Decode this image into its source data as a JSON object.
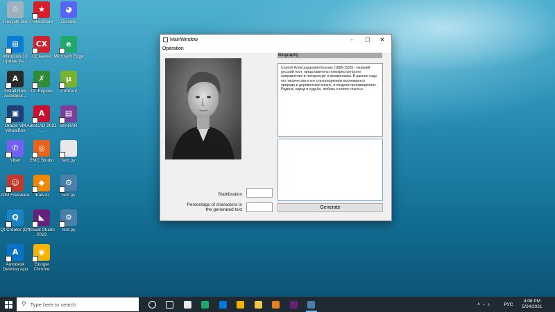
{
  "desktop_icons": [
    {
      "label": "Recycle Bin",
      "icon": "recycle-bin-icon",
      "color": "#9fb0bf"
    },
    {
      "label": "PokerStars",
      "icon": "pokerstars-icon",
      "color": "#d3202a"
    },
    {
      "label": "Discord",
      "icon": "discord-icon",
      "color": "#5865f2"
    },
    {
      "label": "Windows 10 Update As...",
      "icon": "windows-update-icon",
      "color": "#0a7cd4"
    },
    {
      "label": "CCleaner",
      "icon": "ccleaner-icon",
      "color": "#d3202a"
    },
    {
      "label": "Microsoft Edge",
      "icon": "edge-icon",
      "color": "#1fa86b"
    },
    {
      "label": "Install New Autodesk...",
      "icon": "autodesk-icon",
      "color": "#2a2a2a"
    },
    {
      "label": "Dr. Explain",
      "icon": "dr-explain-icon",
      "color": "#2e8b3a"
    },
    {
      "label": "uTorrent",
      "icon": "utorrent-icon",
      "color": "#77b32e"
    },
    {
      "label": "Oracle VM VirtualBox",
      "icon": "virtualbox-icon",
      "color": "#1c3f7a"
    },
    {
      "label": "AutoCAD 2021 -...",
      "icon": "autocad-icon",
      "color": "#c8102e"
    },
    {
      "label": "WinRAR",
      "icon": "winrar-icon",
      "color": "#7b3f99"
    },
    {
      "label": "Viber",
      "icon": "viber-icon",
      "color": "#7360f2"
    },
    {
      "label": "EMC Studio",
      "icon": "emc-studio-icon",
      "color": "#e8621c"
    },
    {
      "label": "text.py",
      "icon": "document-icon",
      "color": "#e8e8e8"
    },
    {
      "label": "IDM Freeware",
      "icon": "idm-icon",
      "color": "#c0392b"
    },
    {
      "label": "draw.io",
      "icon": "drawio-icon",
      "color": "#f08705"
    },
    {
      "label": "text.py",
      "icon": "python-file-icon",
      "color": "#4a7fa8"
    },
    {
      "label": "Qt Creator (Qt)",
      "icon": "qt-creator-icon",
      "color": "#1c82c4"
    },
    {
      "label": "Visual Studio 2019",
      "icon": "visual-studio-icon",
      "color": "#68217a"
    },
    {
      "label": "text.py",
      "icon": "python-file-icon",
      "color": "#4a7fa8"
    },
    {
      "label": "Autodesk Desktop App",
      "icon": "autodesk-desktop-icon",
      "color": "#0b73c7"
    },
    {
      "label": "Google Chrome",
      "icon": "chrome-icon",
      "color": "#f4b400"
    }
  ],
  "window": {
    "title": "MainWindow",
    "menu": [
      "Operation"
    ],
    "section_title": "Biography",
    "biography_text": "Сергей Александрович Есенин (1895-1925) - великий русский поэт, представитель новокрестьянского направления в литературе и имажинизма. В ранние годы его творчества в его стихотворениях воспеваются природа и деревенская жизнь; в поздних произведениях - Родина, народ и судьба, любовь и поиск счастья.",
    "label_stabilization": "Stabilization",
    "label_chars": "Percentage of characters in the generated text",
    "stabilization_value": "",
    "chars_value": "",
    "output_text": "",
    "generate_label": "Generate"
  },
  "taskbar": {
    "search_placeholder": "Type here to search",
    "pinned": [
      "task-view-icon",
      "taskbar-app-icon",
      "store-icon",
      "edge-icon",
      "mail-icon",
      "chrome-icon",
      "file-explorer-icon",
      "photos-icon",
      "visual-studio-icon",
      "python-icon"
    ],
    "language": "РУС",
    "time": "4:08 PM",
    "date": "5/24/2021"
  },
  "colors": {
    "accent": "#0078d7",
    "taskbar_bg": "#1f2a33"
  }
}
